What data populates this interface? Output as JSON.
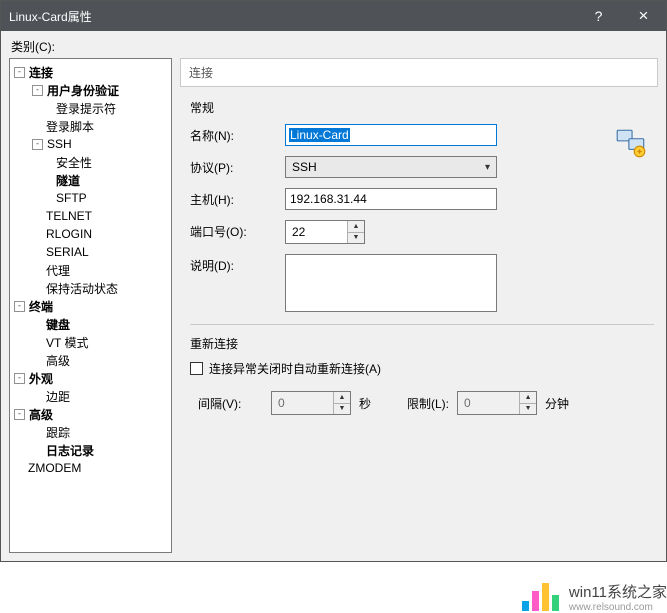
{
  "title": "Linux-Card属性",
  "titlebar": {
    "help": "?",
    "close": "×"
  },
  "category_label": "类别(C):",
  "tree": {
    "connection": "连接",
    "user_auth": "用户身份验证",
    "login_prompt": "登录提示符",
    "login_script": "登录脚本",
    "ssh": "SSH",
    "security": "安全性",
    "tunnel": "隧道",
    "sftp": "SFTP",
    "telnet": "TELNET",
    "rlogin": "RLOGIN",
    "serial": "SERIAL",
    "proxy": "代理",
    "keepalive": "保持活动状态",
    "terminal": "终端",
    "keyboard": "键盘",
    "vt": "VT 模式",
    "advanced_t": "高级",
    "appearance": "外观",
    "margin": "边距",
    "advanced": "高级",
    "trace": "跟踪",
    "log": "日志记录",
    "zmodem": "ZMODEM"
  },
  "right": {
    "section": "连接",
    "general": "常规",
    "name_lbl": "名称(N):",
    "name_val": "Linux-Card",
    "proto_lbl": "协议(P):",
    "proto_val": "SSH",
    "host_lbl": "主机(H):",
    "host_val": "192.168.31.44",
    "port_lbl": "端口号(O):",
    "port_val": "22",
    "desc_lbl": "说明(D):",
    "reconnect": "重新连接",
    "cb_label": "连接异常关闭时自动重新连接(A)",
    "interval_lbl": "间隔(V):",
    "interval_val": "0",
    "sec": "秒",
    "limit_lbl": "限制(L):",
    "limit_val": "0",
    "min": "分钟"
  },
  "watermark": {
    "text": "win11系统之家",
    "url": "www.relsound.com"
  }
}
